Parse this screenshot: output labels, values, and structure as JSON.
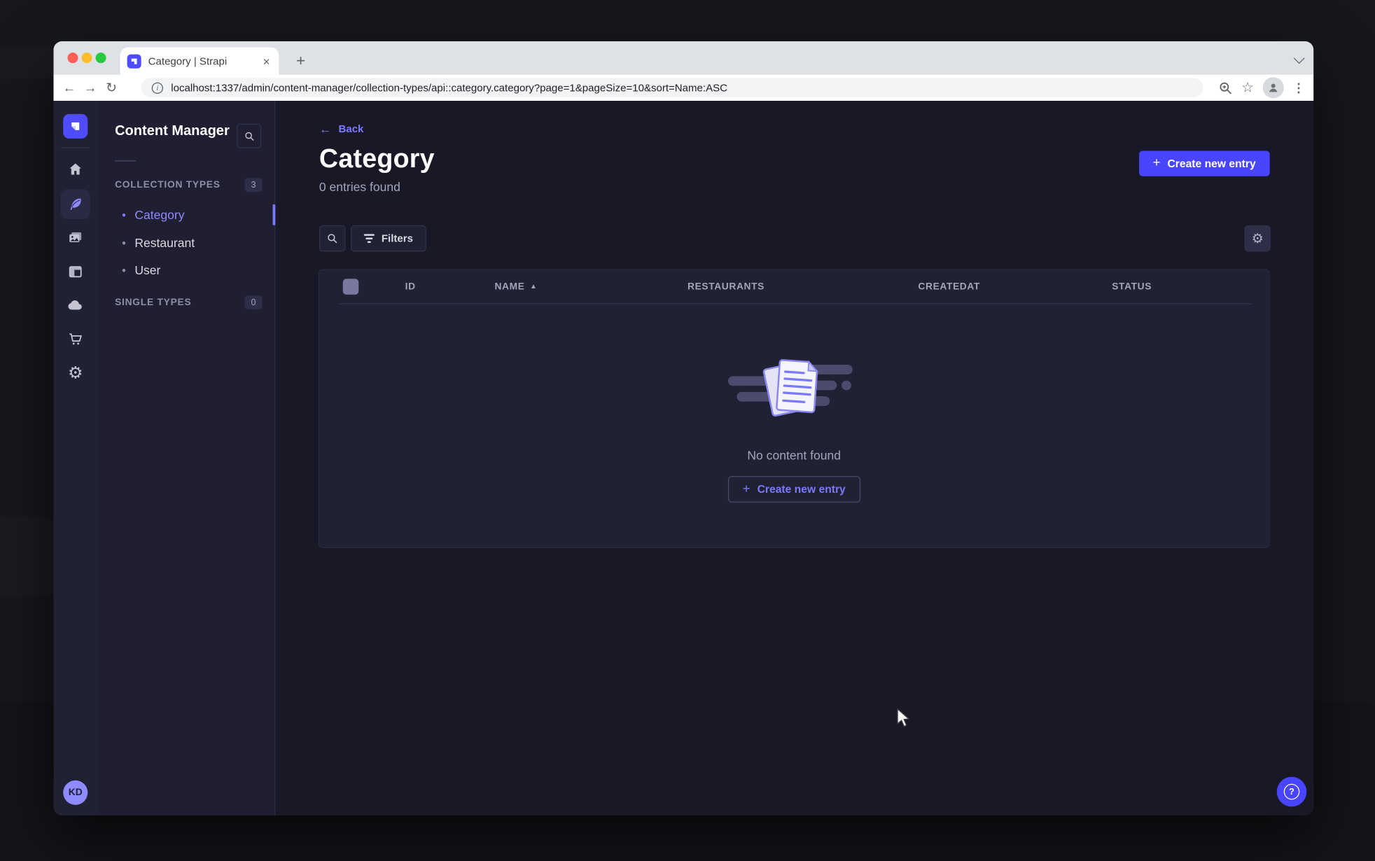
{
  "browser": {
    "tab_title": "Category | Strapi",
    "url": "localhost:1337/admin/content-manager/collection-types/api::category.category?page=1&pageSize=10&sort=Name:ASC"
  },
  "rail": {
    "icons": [
      "strapi-logo",
      "home",
      "content-manager",
      "media-library",
      "content-type-builder",
      "cloud",
      "marketplace",
      "settings"
    ],
    "active_icon": "content-manager"
  },
  "panel": {
    "title": "Content Manager",
    "collection_types": {
      "label": "COLLECTION TYPES",
      "badge": "3",
      "items": [
        {
          "label": "Category",
          "active": true
        },
        {
          "label": "Restaurant",
          "active": false
        },
        {
          "label": "User",
          "active": false
        }
      ]
    },
    "single_types": {
      "label": "SINGLE TYPES",
      "badge": "0"
    }
  },
  "main": {
    "back_label": "Back",
    "title": "Category",
    "subtitle": "0 entries found",
    "create_button": "Create new entry",
    "filters_label": "Filters"
  },
  "table": {
    "columns": [
      "ID",
      "NAME",
      "RESTAURANTS",
      "CREATEDAT",
      "STATUS"
    ],
    "sorted_column": "NAME",
    "sort_direction": "ASC",
    "rows": []
  },
  "empty_state": {
    "message": "No content found",
    "create_button": "Create new entry"
  },
  "user": {
    "initials": "KD"
  },
  "glyphs": {
    "close": "×",
    "plus": "+",
    "back_arrow": "←",
    "forward_arrow": "→",
    "reload": "↻",
    "star": "☆",
    "dots": "⋮",
    "gear": "⚙",
    "sort_asc": "▲",
    "bullet": "•",
    "question": "?",
    "info": "i",
    "arrow_left": "←"
  },
  "colors": {
    "primary": "#4945ff",
    "primary_light": "#7b79ff",
    "background": "#181826",
    "surface": "#212134",
    "border": "#32324d",
    "text_muted": "#a5a5ba"
  }
}
